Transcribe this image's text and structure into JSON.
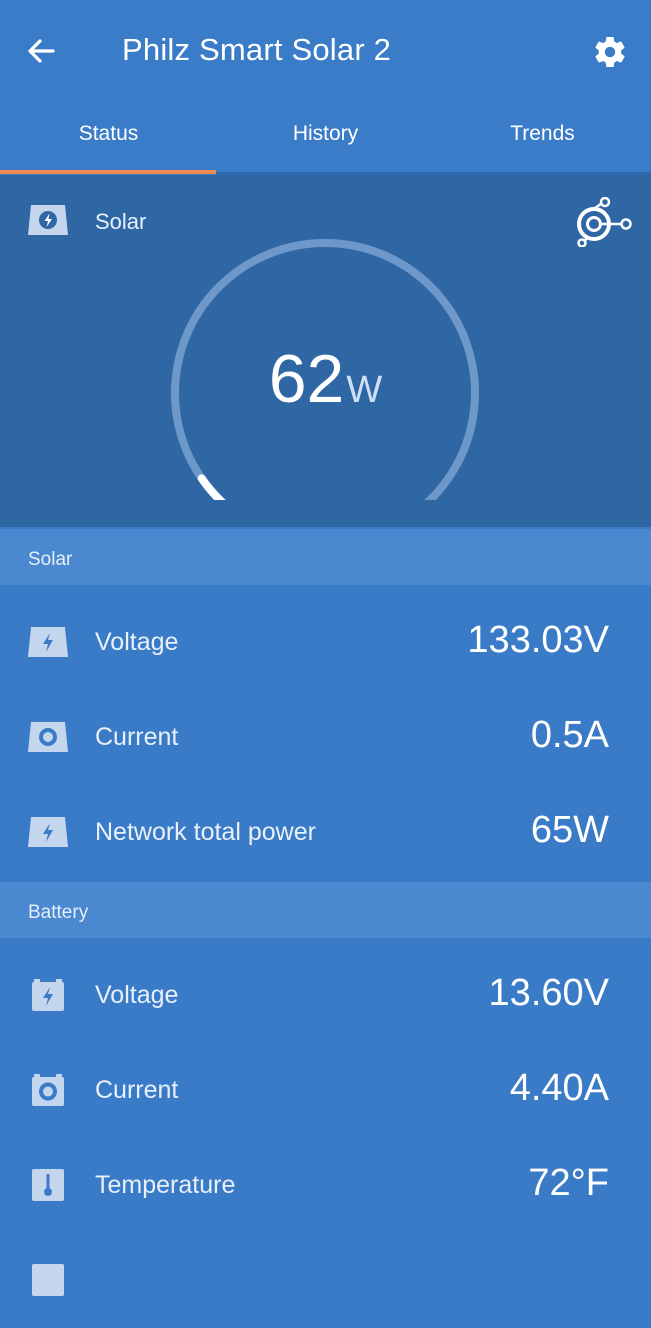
{
  "header": {
    "title": "Philz Smart Solar 2",
    "back_icon": "arrow-left-icon",
    "settings_icon": "gear-icon"
  },
  "tabs": [
    {
      "label": "Status",
      "active": true
    },
    {
      "label": "History",
      "active": false
    },
    {
      "label": "Trends",
      "active": false
    }
  ],
  "gauge": {
    "label": "Solar",
    "value": "62",
    "unit": "W",
    "fill_fraction": 0.07
  },
  "solar_section": {
    "title": "Solar",
    "rows": [
      {
        "label": "Voltage",
        "value": "133.03V",
        "icon": "solar-bolt-icon"
      },
      {
        "label": "Current",
        "value": "0.5A",
        "icon": "solar-current-icon"
      },
      {
        "label": "Network total power",
        "value": "65W",
        "icon": "solar-bolt-icon"
      }
    ]
  },
  "battery_section": {
    "title": "Battery",
    "rows": [
      {
        "label": "Voltage",
        "value": "13.60V",
        "icon": "battery-bolt-icon"
      },
      {
        "label": "Current",
        "value": "4.40A",
        "icon": "battery-current-icon"
      },
      {
        "label": "Temperature",
        "value": "72°F",
        "icon": "thermometer-icon"
      }
    ]
  },
  "colors": {
    "accent": "#f08a52",
    "appbar": "#3b7cc9",
    "panel": "#2f67a5",
    "section": "#4a89d0"
  }
}
